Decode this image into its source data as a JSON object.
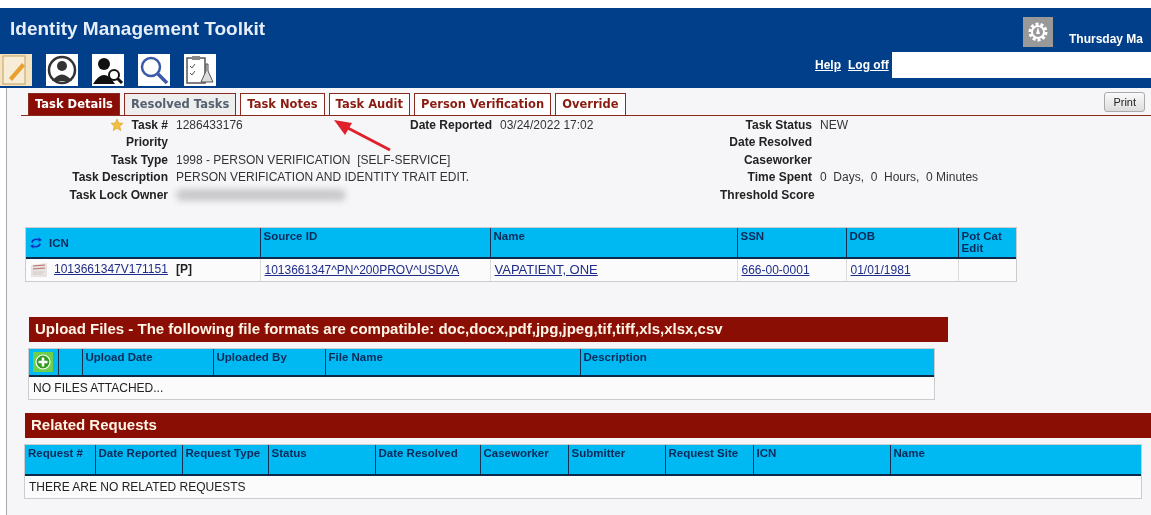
{
  "header": {
    "title": "Identity Management Toolkit",
    "date_text": "Thursday Ma",
    "links": [
      "Help",
      "Log off"
    ]
  },
  "tabs": [
    {
      "label": "Task Details",
      "selected": true,
      "disabled": false
    },
    {
      "label": "Resolved Tasks",
      "selected": false,
      "disabled": true
    },
    {
      "label": "Task Notes",
      "selected": false,
      "disabled": false
    },
    {
      "label": "Task Audit",
      "selected": false,
      "disabled": false
    },
    {
      "label": "Person Verification",
      "selected": false,
      "disabled": false
    },
    {
      "label": "Override",
      "selected": false,
      "disabled": false
    }
  ],
  "print_button": "Print",
  "task_info": {
    "left": [
      {
        "label": "Task #",
        "value": "1286433176",
        "starred": true
      },
      {
        "label": "Priority"
      },
      {
        "label": "Task Type",
        "value": "1998 - PERSON VERIFICATION  [SELF-SERVICE]"
      },
      {
        "label": "Task Description",
        "value": "PERSON VERIFICATION AND IDENTITY TRAIT EDIT."
      },
      {
        "label": "Task Lock Owner",
        "redacted": true
      }
    ],
    "middle": [
      {
        "label": "Date Reported",
        "value": "03/24/2022 17:02"
      }
    ],
    "right": [
      {
        "label": "Task Status",
        "value": "NEW"
      },
      {
        "label": "Date Resolved"
      },
      {
        "label": "Caseworker"
      },
      {
        "label": "Time Spent",
        "value": "0  Days,  0  Hours,  0 Minutes"
      },
      {
        "label": "Threshold Score"
      }
    ]
  },
  "person_table": {
    "columns": [
      "ICN",
      "Source ID",
      "Name",
      "SSN",
      "DOB",
      "Pot Cat Edit"
    ],
    "rows": [
      {
        "icn": "1013661347V171151",
        "icn_tag": "[P]",
        "source_id": "1013661347^PN^200PROV^USDVA",
        "name": "VAPATIENT, ONE",
        "ssn": "666-00-0001",
        "dob": "01/01/1981"
      }
    ]
  },
  "upload_files": {
    "title": "Upload Files - The following file formats are compatible: doc,docx,pdf,jpg,jpeg,tif,tiff,xls,xlsx,csv",
    "columns": [
      "Upload Date",
      "Uploaded By",
      "File Name",
      "Description"
    ],
    "empty_message": "NO FILES ATTACHED..."
  },
  "related_requests": {
    "title": "Related Requests",
    "columns": [
      "Request #",
      "Date Reported",
      "Request Type",
      "Status",
      "Date Resolved",
      "Caseworker",
      "Submitter",
      "Request Site",
      "ICN",
      "Name"
    ],
    "empty_message": "THERE ARE NO RELATED REQUESTS"
  }
}
